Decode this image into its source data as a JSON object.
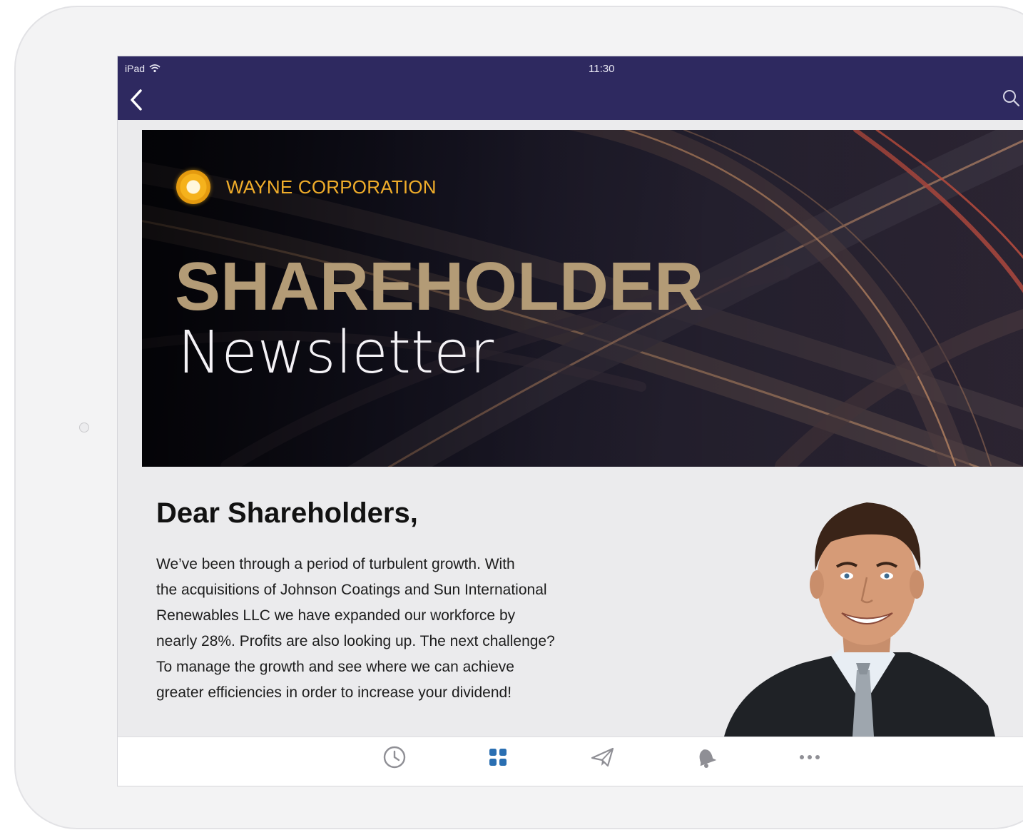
{
  "status_bar": {
    "device": "iPad",
    "time": "11:30"
  },
  "nav": {
    "back_icon": "chevron-left-icon",
    "search_icon": "search-icon"
  },
  "hero": {
    "brand_name": "WAYNE CORPORATION",
    "title": "SHAREHOLDER",
    "subtitle": "Newsletter"
  },
  "letter": {
    "heading": "Dear Shareholders,",
    "lines": [
      "We’ve been through a period of turbulent growth. With",
      "the acquisitions of Johnson Coatings and Sun International",
      "Renewables LLC we have expanded our workforce by",
      "nearly 28%. Profits are also looking up. The next challenge?",
      "To manage the growth and see where we can achieve",
      "greater efficiencies in order to increase your dividend!"
    ]
  },
  "tabbar": {
    "tabs": [
      {
        "icon": "clock-icon",
        "active": false
      },
      {
        "icon": "grid-icon",
        "active": true
      },
      {
        "icon": "paper-plane-icon",
        "active": false
      },
      {
        "icon": "bell-icon",
        "active": false
      },
      {
        "icon": "more-icon",
        "active": false
      }
    ]
  },
  "colors": {
    "nav_bg": "#2e2960",
    "brand_orange": "#f0ad2a",
    "title_gold": "#b39b76",
    "active_tab": "#2a6fb2",
    "inactive_tab": "#8f8f95"
  }
}
